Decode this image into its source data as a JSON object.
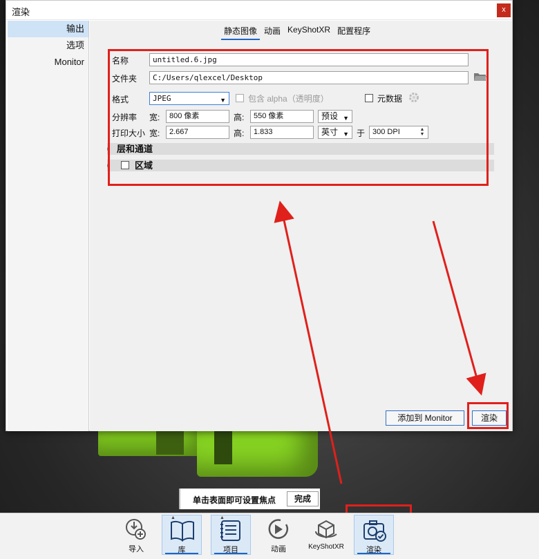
{
  "window": {
    "title": "渲染",
    "close_glyph": "x"
  },
  "sidebar": {
    "items": [
      {
        "label": "输出",
        "active": true
      },
      {
        "label": "选项",
        "active": false
      },
      {
        "label": "Monitor",
        "active": false
      }
    ]
  },
  "tabs": [
    {
      "label": "静态图像",
      "active": true
    },
    {
      "label": "动画",
      "active": false
    },
    {
      "label": "KeyShotXR",
      "active": false
    },
    {
      "label": "配置程序",
      "active": false
    }
  ],
  "form": {
    "name_label": "名称",
    "name_value": "untitled.6.jpg",
    "folder_label": "文件夹",
    "folder_value": "C:/Users/qlexcel/Desktop",
    "format_label": "格式",
    "format_value": "JPEG",
    "alpha_label": "包含 alpha（透明度）",
    "metadata_label": "元数据",
    "resolution_label": "分辨率",
    "width_label": "宽:",
    "width_value": "800 像素",
    "height_label": "高:",
    "height_value": "550 像素",
    "preset_value": "预设",
    "print_label": "打印大小",
    "print_width_label": "宽:",
    "print_width_value": "2.667",
    "print_height_label": "高:",
    "print_height_value": "1.833",
    "unit_value": "英寸",
    "at_label": "于",
    "dpi_value": "300 DPI"
  },
  "sections": [
    {
      "label": "层和通道"
    },
    {
      "label": "区域"
    }
  ],
  "buttons": {
    "add_to_monitor": "添加到 Monitor",
    "render": "渲染"
  },
  "hint": {
    "text": "单击表面即可设置焦点",
    "done": "完成"
  },
  "toolbar": [
    {
      "label": "导入",
      "icon": "import-icon",
      "active": false
    },
    {
      "label": "库",
      "icon": "library-book-icon",
      "active": true
    },
    {
      "label": "项目",
      "icon": "project-list-icon",
      "active": true
    },
    {
      "label": "动画",
      "icon": "animation-play-icon",
      "active": false
    },
    {
      "label": "KeyShotXR",
      "icon": "keyshotxr-cube-icon",
      "active": false
    },
    {
      "label": "渲染",
      "icon": "render-camera-icon",
      "active": true
    }
  ],
  "colors": {
    "accent": "#1c66c4",
    "annotation": "#e0201b",
    "close": "#c42b1c",
    "model": "#7fc81f"
  }
}
